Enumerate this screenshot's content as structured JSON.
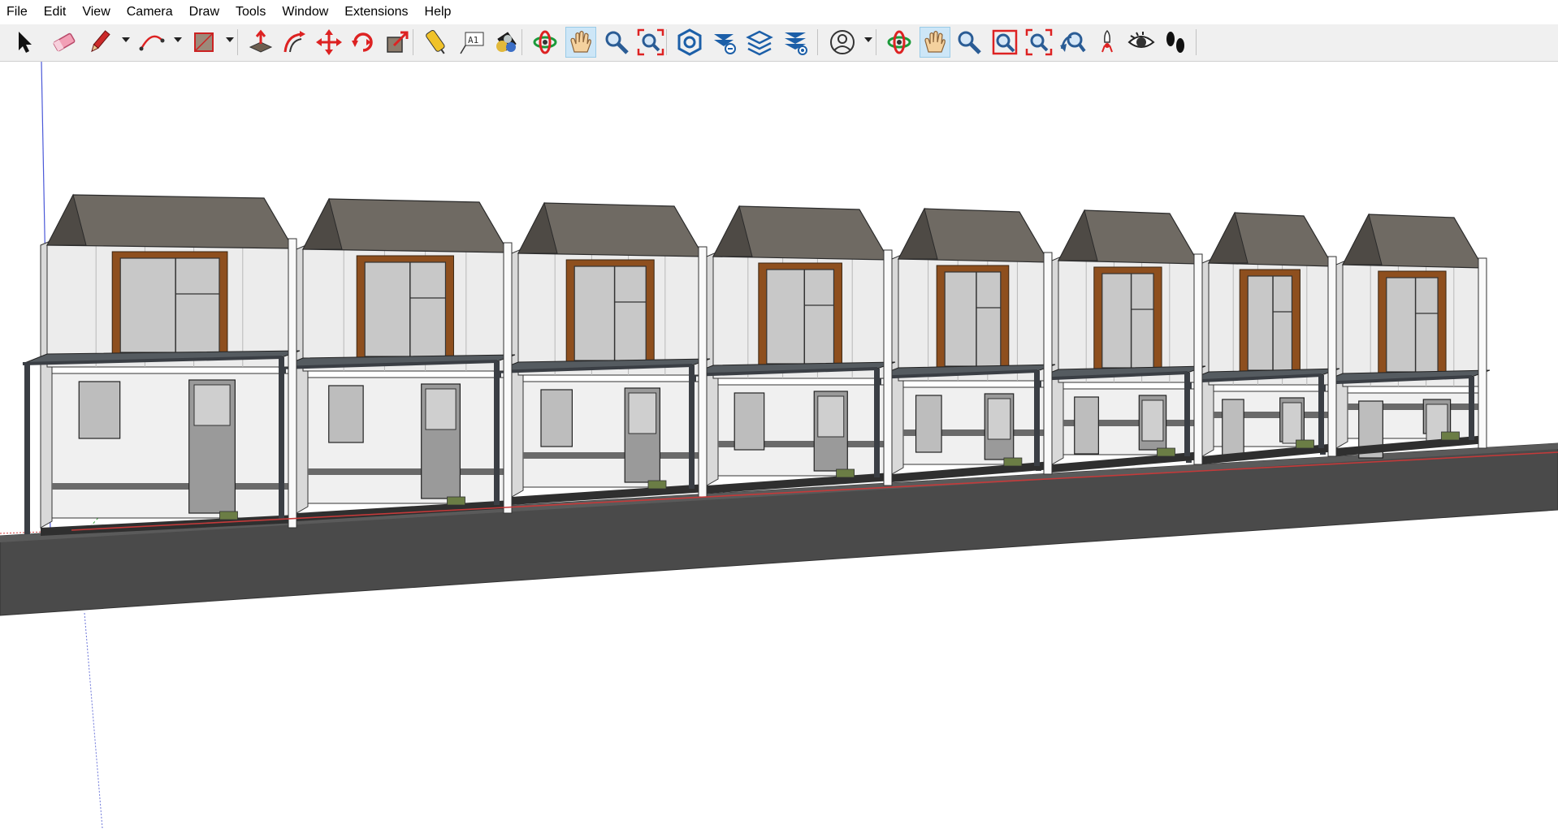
{
  "menu": [
    "File",
    "Edit",
    "View",
    "Camera",
    "Draw",
    "Tools",
    "Window",
    "Extensions",
    "Help"
  ],
  "toolbar": {
    "tools": [
      {
        "name": "select-tool",
        "icon": "arrow-cursor-icon"
      },
      {
        "name": "eraser-tool",
        "icon": "eraser-icon"
      },
      {
        "name": "line-tool",
        "icon": "pencil-icon",
        "dropdown": true
      },
      {
        "name": "arc-tool",
        "icon": "arc-icon",
        "dropdown": true
      },
      {
        "name": "rectangle-tool",
        "icon": "rectangle-icon",
        "dropdown": true
      },
      {
        "name": "push-pull-tool",
        "icon": "push-pull-icon"
      },
      {
        "name": "offset-tool",
        "icon": "offset-icon"
      },
      {
        "name": "move-tool",
        "icon": "move-icon"
      },
      {
        "name": "rotate-tool",
        "icon": "rotate-icon"
      },
      {
        "name": "scale-tool",
        "icon": "scale-icon"
      },
      {
        "name": "tape-measure-tool",
        "icon": "tape-measure-icon"
      },
      {
        "name": "text-tool",
        "icon": "text-icon",
        "label": "A1"
      },
      {
        "name": "paint-bucket-tool",
        "icon": "paint-bucket-icon"
      },
      {
        "name": "orbit-tool",
        "icon": "orbit-icon"
      },
      {
        "name": "pan-tool",
        "icon": "pan-hand-icon",
        "active": true
      },
      {
        "name": "zoom-tool",
        "icon": "magnifier-icon"
      },
      {
        "name": "zoom-extents-tool",
        "icon": "zoom-extents-icon"
      },
      {
        "name": "3d-warehouse-button",
        "icon": "warehouse-icon"
      },
      {
        "name": "extension-warehouse-button",
        "icon": "extension-warehouse-icon"
      },
      {
        "name": "layout-send-button",
        "icon": "layout-send-icon"
      },
      {
        "name": "extension-manager-button",
        "icon": "extension-manager-icon"
      },
      {
        "name": "account-button",
        "icon": "user-account-icon",
        "dropdown": true
      },
      {
        "name": "orbit-tool-2",
        "icon": "orbit-icon"
      },
      {
        "name": "pan-tool-2",
        "icon": "pan-hand-icon",
        "active": true
      },
      {
        "name": "zoom-tool-2",
        "icon": "magnifier-icon"
      },
      {
        "name": "zoom-window-tool",
        "icon": "zoom-window-icon"
      },
      {
        "name": "zoom-extents-tool-2",
        "icon": "zoom-extents-icon"
      },
      {
        "name": "previous-view-tool",
        "icon": "previous-view-icon"
      },
      {
        "name": "position-camera-tool",
        "icon": "position-camera-icon"
      },
      {
        "name": "look-around-tool",
        "icon": "eye-icon"
      },
      {
        "name": "walk-tool",
        "icon": "footprints-icon"
      }
    ]
  },
  "model": {
    "unit_count": 8,
    "colors": {
      "roof": "#6f6a63",
      "wall": "#ececec",
      "wood_frame": "#8e4f1e",
      "window_glass": "#c8c8c8",
      "steel_frame": "#3a3e44",
      "road": "#4a4a4a",
      "porch_floor": "#2f2f2f",
      "grass": "#6b7d45",
      "property_line": "#c43a3a"
    }
  }
}
